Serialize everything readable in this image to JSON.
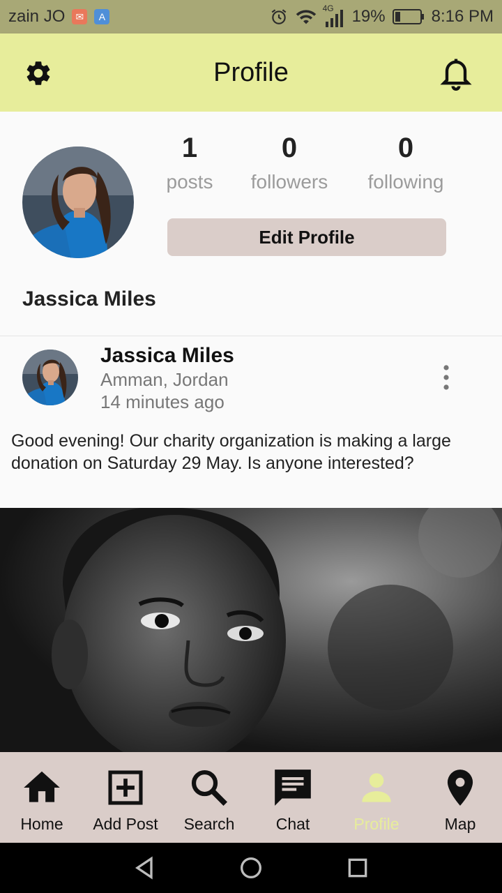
{
  "status_bar": {
    "carrier": "zain JO",
    "network": "4G",
    "battery": "19%",
    "time": "8:16 PM"
  },
  "header": {
    "title": "Profile",
    "settings_icon": "gear-icon",
    "notification_icon": "bell-icon"
  },
  "profile": {
    "name": "Jassica Miles",
    "stats": [
      {
        "value": "1",
        "label": "posts"
      },
      {
        "value": "0",
        "label": "followers"
      },
      {
        "value": "0",
        "label": "following"
      }
    ],
    "edit_label": "Edit Profile"
  },
  "post": {
    "author": "Jassica Miles",
    "location": "Amman, Jordan",
    "time": "14 minutes ago",
    "text": "Good evening! Our charity organization is making a large donation on Saturday 29 May. Is anyone interested?"
  },
  "bottom_nav": [
    {
      "label": "Home",
      "icon": "home-icon"
    },
    {
      "label": "Add Post",
      "icon": "add-box-icon"
    },
    {
      "label": "Search",
      "icon": "search-icon"
    },
    {
      "label": "Chat",
      "icon": "chat-icon"
    },
    {
      "label": "Profile",
      "icon": "person-icon",
      "active": true
    },
    {
      "label": "Map",
      "icon": "map-pin-icon"
    }
  ],
  "colors": {
    "app_bar": "#e7ed9b",
    "status_bar": "#a8a876",
    "nav_bar": "#dacdc9",
    "edit_button": "#dacdc9",
    "active_nav": "#e7ed9b"
  }
}
